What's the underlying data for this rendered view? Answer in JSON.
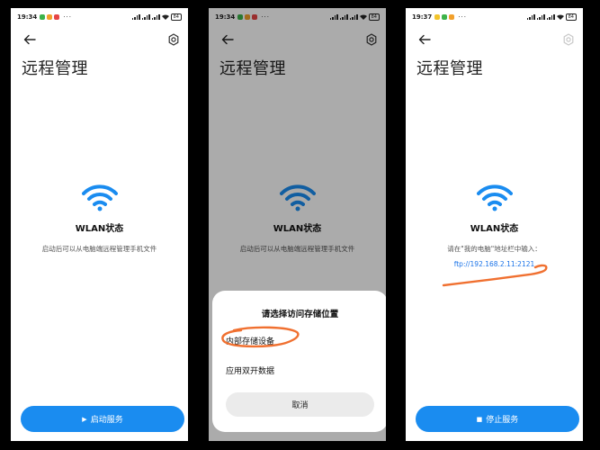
{
  "screens": [
    {
      "status_time": "19:34",
      "status_dots": "···",
      "battery": "84",
      "title": "远程管理",
      "wlan_title": "WLAN状态",
      "description": "启动后可以从电脑端远程管理手机文件",
      "button_icon": "▶",
      "button_label": "启动服务"
    },
    {
      "status_time": "19:34",
      "status_dots": "···",
      "battery": "84",
      "title": "远程管理",
      "wlan_title": "WLAN状态",
      "description": "启动后可以从电脑端远程管理手机文件",
      "dialog": {
        "title": "请选择访问存储位置",
        "option_internal": "内部存储设备",
        "option_dual_app": "应用双开数据",
        "cancel": "取消"
      }
    },
    {
      "status_time": "19:37",
      "status_dots": "···",
      "battery": "84",
      "title": "远程管理",
      "wlan_title": "WLAN状态",
      "description": "请在\"我的电脑\"地址栏中输入：",
      "ftp_address": "ftp://192.168.2.11:2121",
      "button_icon": "■",
      "button_label": "停止服务"
    }
  ],
  "icons": [
    "back-arrow-icon",
    "gear-icon",
    "wifi-icon",
    "play-icon",
    "stop-icon"
  ],
  "colors": {
    "accent": "#1a8cf0",
    "link": "#1a73e8",
    "annotation": "#f07030"
  }
}
